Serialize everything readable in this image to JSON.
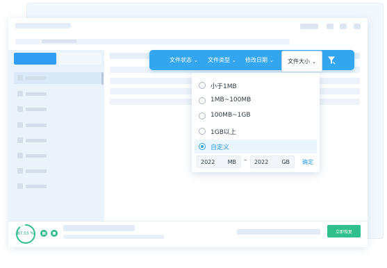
{
  "filter_bar": {
    "items": [
      {
        "label": "文件状态"
      },
      {
        "label": "文件类型"
      },
      {
        "label": "修改日期"
      },
      {
        "label": "文件大小"
      }
    ],
    "active_index": 3,
    "chevron_icon": "chevron-down-icon",
    "filter_icon": "filter-icon",
    "bg_color": "#34a6f0"
  },
  "size_dropdown": {
    "options": [
      {
        "label": "小于1MB",
        "selected": false
      },
      {
        "label": "1MB~100MB",
        "selected": false
      },
      {
        "label": "100MB~1GB",
        "selected": false
      },
      {
        "label": "1GB以上",
        "selected": false
      },
      {
        "label": "自定义",
        "selected": true
      }
    ],
    "custom_range": {
      "min_value": "2022",
      "min_unit": "MB",
      "separator": "–",
      "max_value": "2022",
      "max_unit": "GB",
      "confirm_label": "确定"
    },
    "accent_color": "#2b9ef0"
  },
  "status_bar": {
    "progress_text": "87.55 %",
    "progress_fraction": 0.8755,
    "recover_label": "立即恢复",
    "accent_color": "#2fc08d"
  }
}
